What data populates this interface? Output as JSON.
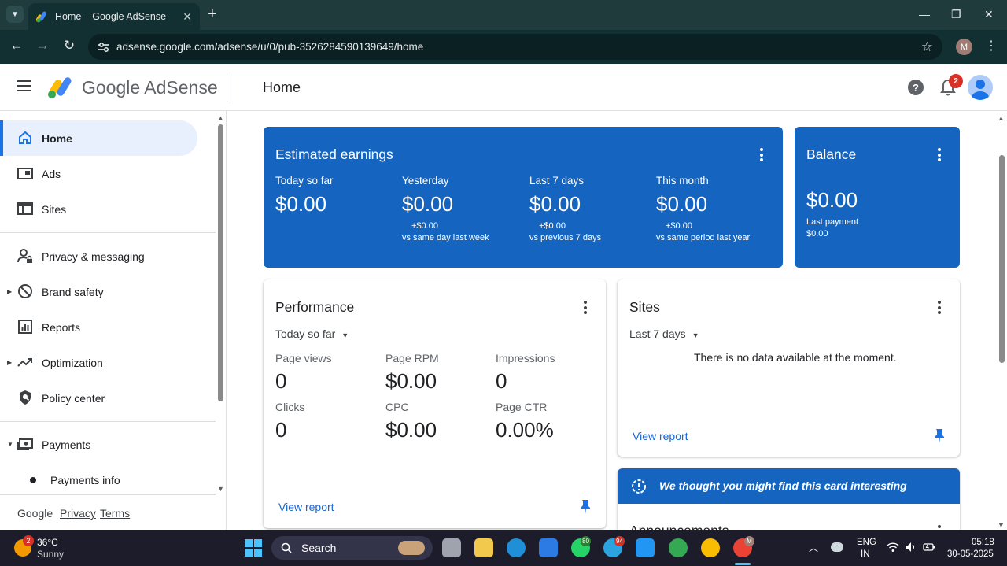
{
  "browser": {
    "tab_title": "Home – Google AdSense",
    "url": "adsense.google.com/adsense/u/0/pub-3526284590139649/home",
    "profile_initial": "M"
  },
  "header": {
    "brand": "Google AdSense",
    "page_title": "Home",
    "notification_count": "2"
  },
  "sidebar": {
    "items": [
      {
        "label": "Home",
        "icon": "home-icon"
      },
      {
        "label": "Ads",
        "icon": "ads-icon"
      },
      {
        "label": "Sites",
        "icon": "sites-icon"
      },
      {
        "label": "Privacy & messaging",
        "icon": "privacy-icon"
      },
      {
        "label": "Brand safety",
        "icon": "block-icon"
      },
      {
        "label": "Reports",
        "icon": "reports-icon"
      },
      {
        "label": "Optimization",
        "icon": "trending-icon"
      },
      {
        "label": "Policy center",
        "icon": "policy-shield-icon"
      },
      {
        "label": "Payments",
        "icon": "payments-icon"
      }
    ],
    "sub_item": "Payments info",
    "footer": {
      "google": "Google",
      "privacy": "Privacy",
      "terms": "Terms"
    }
  },
  "earnings": {
    "title": "Estimated earnings",
    "cols": [
      {
        "label": "Today so far",
        "value": "$0.00",
        "delta": "",
        "compare": ""
      },
      {
        "label": "Yesterday",
        "value": "$0.00",
        "delta": "+$0.00",
        "compare": "vs same day last week"
      },
      {
        "label": "Last 7 days",
        "value": "$0.00",
        "delta": "+$0.00",
        "compare": "vs previous 7 days"
      },
      {
        "label": "This month",
        "value": "$0.00",
        "delta": "+$0.00",
        "compare": "vs same period last year"
      }
    ]
  },
  "balance": {
    "title": "Balance",
    "value": "$0.00",
    "last_payment_label": "Last payment",
    "last_payment_value": "$0.00"
  },
  "performance": {
    "title": "Performance",
    "period": "Today so far",
    "metrics": [
      {
        "label": "Page views",
        "value": "0"
      },
      {
        "label": "Page RPM",
        "value": "$0.00"
      },
      {
        "label": "Impressions",
        "value": "0"
      },
      {
        "label": "Clicks",
        "value": "0"
      },
      {
        "label": "CPC",
        "value": "$0.00"
      },
      {
        "label": "Page CTR",
        "value": "0.00%"
      }
    ],
    "view_report": "View report"
  },
  "sites_card": {
    "title": "Sites",
    "period": "Last 7 days",
    "empty_message": "There is no data available at the moment.",
    "view_report": "View report"
  },
  "suggestion": {
    "text": "We thought you might find this card interesting"
  },
  "announcements": {
    "title": "Announcements"
  },
  "taskbar": {
    "weather_badge": "2",
    "temperature": "36°C",
    "condition": "Sunny",
    "search_placeholder": "Search",
    "whatsapp_badge": "80",
    "telegram_badge": "94",
    "chrome_profile_initial": "M",
    "lang_top": "ENG",
    "lang_bottom": "IN",
    "time": "05:18",
    "date": "30-05-2025"
  }
}
